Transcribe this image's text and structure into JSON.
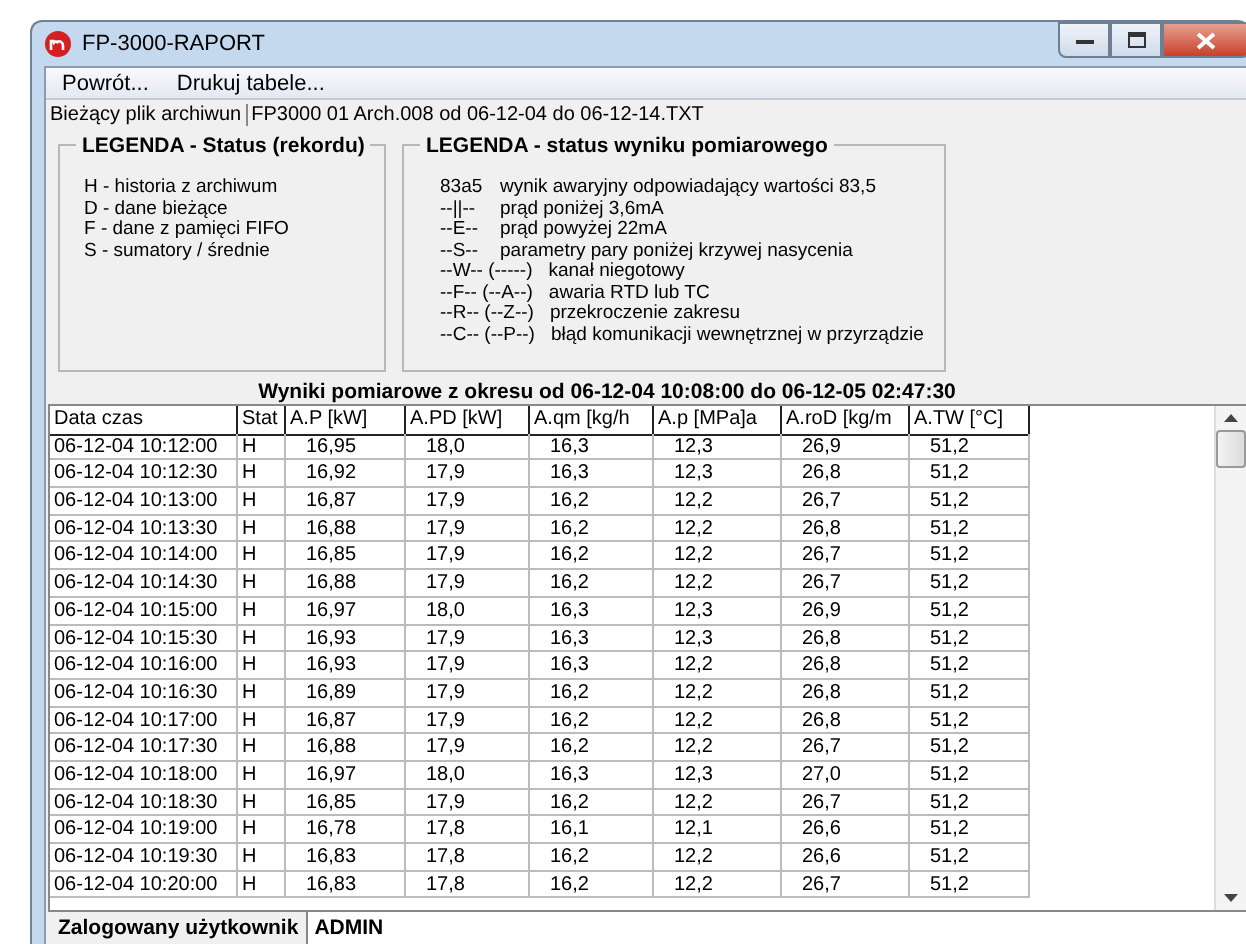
{
  "window": {
    "title": "FP-3000-RAPORT"
  },
  "menu": [
    "Powrót...",
    "Drukuj tabele..."
  ],
  "archive": {
    "label": "Bieżący plik archiwun",
    "value": "FP3000 01 Arch.008 od 06-12-04 do 06-12-14.TXT"
  },
  "legend_status": {
    "title": "LEGENDA - Status (rekordu)",
    "items": [
      "H - historia z archiwum",
      "D - dane bieżące",
      "F - dane z pamięci FIFO",
      "S - sumatory / średnie"
    ]
  },
  "legend_result": {
    "title": "LEGENDA - status wyniku pomiarowego",
    "items": [
      {
        "code": "83a5",
        "text": "wynik awaryjny odpowiadający wartości 83,5"
      },
      {
        "code": "--||--",
        "text": "prąd poniżej 3,6mA"
      },
      {
        "code": "--E--",
        "text": "prąd powyżej 22mA"
      },
      {
        "code": "--S--",
        "text": "parametry pary poniżej krzywej nasycenia"
      },
      {
        "code": "--W-- (-----)",
        "text": "kanał niegotowy"
      },
      {
        "code": "--F-- (--A--)",
        "text": "awaria RTD lub TC"
      },
      {
        "code": "--R-- (--Z--)",
        "text": "przekroczenie zakresu"
      },
      {
        "code": "--C-- (--P--)",
        "text": "błąd komunikacji wewnętrznej w przyrządzie"
      }
    ]
  },
  "table": {
    "title": "Wyniki pomiarowe z okresu od 06-12-04 10:08:00 do 06-12-05 02:47:30",
    "columns": [
      "Data czas",
      "Stat",
      "A.P [kW]",
      "A.PD [kW]",
      "A.qm [kg/h",
      "A.p [MPa]a",
      "A.roD [kg/m",
      "A.TW [°C]"
    ],
    "rows": [
      [
        "06-12-04 10:12:00",
        "H",
        "16,95",
        "18,0",
        "16,3",
        "12,3",
        "26,9",
        "51,2"
      ],
      [
        "06-12-04 10:12:30",
        "H",
        "16,92",
        "17,9",
        "16,3",
        "12,3",
        "26,8",
        "51,2"
      ],
      [
        "06-12-04 10:13:00",
        "H",
        "16,87",
        "17,9",
        "16,2",
        "12,2",
        "26,7",
        "51,2"
      ],
      [
        "06-12-04 10:13:30",
        "H",
        "16,88",
        "17,9",
        "16,2",
        "12,2",
        "26,8",
        "51,2"
      ],
      [
        "06-12-04 10:14:00",
        "H",
        "16,85",
        "17,9",
        "16,2",
        "12,2",
        "26,7",
        "51,2"
      ],
      [
        "06-12-04 10:14:30",
        "H",
        "16,88",
        "17,9",
        "16,2",
        "12,2",
        "26,7",
        "51,2"
      ],
      [
        "06-12-04 10:15:00",
        "H",
        "16,97",
        "18,0",
        "16,3",
        "12,3",
        "26,9",
        "51,2"
      ],
      [
        "06-12-04 10:15:30",
        "H",
        "16,93",
        "17,9",
        "16,3",
        "12,3",
        "26,8",
        "51,2"
      ],
      [
        "06-12-04 10:16:00",
        "H",
        "16,93",
        "17,9",
        "16,3",
        "12,2",
        "26,8",
        "51,2"
      ],
      [
        "06-12-04 10:16:30",
        "H",
        "16,89",
        "17,9",
        "16,2",
        "12,2",
        "26,8",
        "51,2"
      ],
      [
        "06-12-04 10:17:00",
        "H",
        "16,87",
        "17,9",
        "16,2",
        "12,2",
        "26,8",
        "51,2"
      ],
      [
        "06-12-04 10:17:30",
        "H",
        "16,88",
        "17,9",
        "16,2",
        "12,2",
        "26,7",
        "51,2"
      ],
      [
        "06-12-04 10:18:00",
        "H",
        "16,97",
        "18,0",
        "16,3",
        "12,3",
        "27,0",
        "51,2"
      ],
      [
        "06-12-04 10:18:30",
        "H",
        "16,85",
        "17,9",
        "16,2",
        "12,2",
        "26,7",
        "51,2"
      ],
      [
        "06-12-04 10:19:00",
        "H",
        "16,78",
        "17,8",
        "16,1",
        "12,1",
        "26,6",
        "51,2"
      ],
      [
        "06-12-04 10:19:30",
        "H",
        "16,83",
        "17,8",
        "16,2",
        "12,2",
        "26,6",
        "51,2"
      ],
      [
        "06-12-04 10:20:00",
        "H",
        "16,83",
        "17,8",
        "16,2",
        "12,2",
        "26,7",
        "51,2"
      ]
    ]
  },
  "status_bar": {
    "label": "Zalogowany użytkownik",
    "value": "ADMIN"
  }
}
